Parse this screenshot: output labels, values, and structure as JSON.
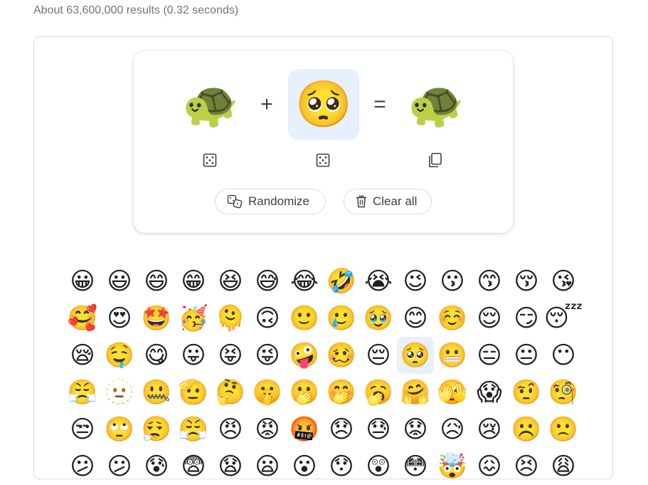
{
  "result_stats": "About 63,600,000 results (0.32 seconds)",
  "kitchen": {
    "left_emoji": "🐢",
    "right_emoji": "🥺",
    "result_emoji": "🐢",
    "plus": "+",
    "equals": "=",
    "randomize_label": "Randomize",
    "clear_label": "Clear all"
  },
  "emoji_grid": [
    "😀",
    "😃",
    "😄",
    "😁",
    "😆",
    "😅",
    "😂",
    "🤣",
    "😭",
    "😉",
    "😗",
    "😙",
    "😚",
    "😘",
    "🥰",
    "😍",
    "🤩",
    "🥳",
    "🫠",
    "🙃",
    "🙂",
    "🥲",
    "🥹",
    "😊",
    "☺️",
    "😌",
    "😏",
    "😴",
    "😪",
    "🤤",
    "😋",
    "😛",
    "😝",
    "😜",
    "🤪",
    "🥴",
    "😔",
    "🥺",
    "😬",
    "😑",
    "😐",
    "😶",
    "😤",
    "🫥",
    "🤐",
    "🫡",
    "🤔",
    "🤫",
    "🫢",
    "🤭",
    "🥱",
    "🤗",
    "🫣",
    "😱",
    "🤨",
    "🧐",
    "😒",
    "🙄",
    "😮‍💨",
    "😤",
    "😠",
    "😡",
    "🤬",
    "😞",
    "😓",
    "😟",
    "😥",
    "😢",
    "☹️",
    "🙁",
    "😕",
    "😕",
    "😰",
    "😨",
    "😧",
    "😦",
    "😮",
    "😯",
    "😲",
    "😳",
    "🤯",
    "😖",
    "😣",
    "😩"
  ],
  "selected_index": 37
}
